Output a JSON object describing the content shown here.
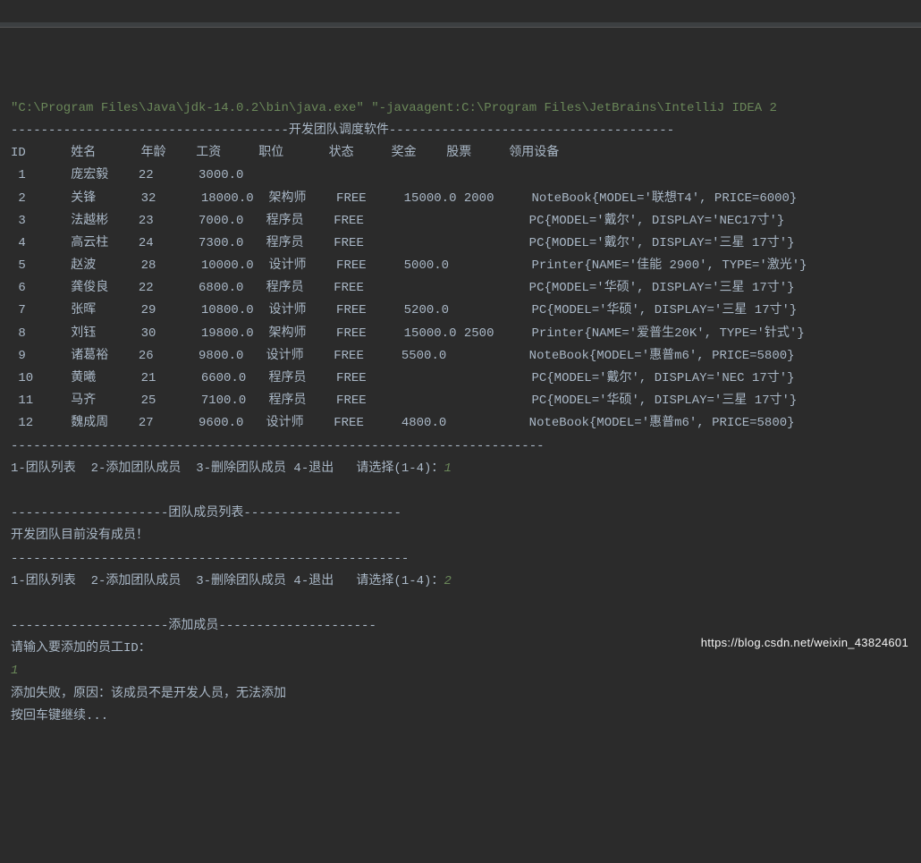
{
  "cmd": "\"C:\\Program Files\\Java\\jdk-14.0.2\\bin\\java.exe\" \"-javaagent:C:\\Program Files\\JetBrains\\IntelliJ IDEA 2",
  "title_rule": "-------------------------------------开发团队调度软件--------------------------------------",
  "headers": [
    "ID",
    "姓名",
    "年龄",
    "工资",
    "职位",
    "状态",
    "奖金",
    "股票",
    "领用设备"
  ],
  "rows": [
    {
      "id": " 1",
      "name": "庞宏毅",
      "age": "22",
      "salary": "3000.0",
      "role": "",
      "status": "",
      "bonus": "",
      "stock": "",
      "equip": ""
    },
    {
      "id": " 2",
      "name": "关锋",
      "age": "32",
      "salary": "18000.0",
      "role": "架构师",
      "status": "FREE",
      "bonus": "15000.0",
      "stock": "2000",
      "equip": "NoteBook{MODEL='联想T4', PRICE=6000}"
    },
    {
      "id": " 3",
      "name": "法越彬",
      "age": "23",
      "salary": "7000.0",
      "role": "程序员",
      "status": "FREE",
      "bonus": "",
      "stock": "",
      "equip": "PC{MODEL='戴尔', DISPLAY='NEC17寸'}"
    },
    {
      "id": " 4",
      "name": "高云柱",
      "age": "24",
      "salary": "7300.0",
      "role": "程序员",
      "status": "FREE",
      "bonus": "",
      "stock": "",
      "equip": "PC{MODEL='戴尔', DISPLAY='三星 17寸'}"
    },
    {
      "id": " 5",
      "name": "赵波",
      "age": "28",
      "salary": "10000.0",
      "role": "设计师",
      "status": "FREE",
      "bonus": "5000.0",
      "stock": "",
      "equip": "Printer{NAME='佳能 2900', TYPE='激光'}"
    },
    {
      "id": " 6",
      "name": "龚俊良",
      "age": "22",
      "salary": "6800.0",
      "role": "程序员",
      "status": "FREE",
      "bonus": "",
      "stock": "",
      "equip": "PC{MODEL='华硕', DISPLAY='三星 17寸'}"
    },
    {
      "id": " 7",
      "name": "张晖",
      "age": "29",
      "salary": "10800.0",
      "role": "设计师",
      "status": "FREE",
      "bonus": "5200.0",
      "stock": "",
      "equip": "PC{MODEL='华硕', DISPLAY='三星 17寸'}"
    },
    {
      "id": " 8",
      "name": "刘钰",
      "age": "30",
      "salary": "19800.0",
      "role": "架构师",
      "status": "FREE",
      "bonus": "15000.0",
      "stock": "2500",
      "equip": "Printer{NAME='爱普生20K', TYPE='针式'}"
    },
    {
      "id": " 9",
      "name": "诸葛裕",
      "age": "26",
      "salary": "9800.0",
      "role": "设计师",
      "status": "FREE",
      "bonus": "5500.0",
      "stock": "",
      "equip": "NoteBook{MODEL='惠普m6', PRICE=5800}"
    },
    {
      "id": " 10",
      "name": "黄曦",
      "age": "21",
      "salary": "6600.0",
      "role": "程序员",
      "status": "FREE",
      "bonus": "",
      "stock": "",
      "equip": "PC{MODEL='戴尔', DISPLAY='NEC 17寸'}"
    },
    {
      "id": " 11",
      "name": "马齐",
      "age": "25",
      "salary": "7100.0",
      "role": "程序员",
      "status": "FREE",
      "bonus": "",
      "stock": "",
      "equip": "PC{MODEL='华硕', DISPLAY='三星 17寸'}"
    },
    {
      "id": " 12",
      "name": "魏成周",
      "age": "27",
      "salary": "9600.0",
      "role": "设计师",
      "status": "FREE",
      "bonus": "4800.0",
      "stock": "",
      "equip": "NoteBook{MODEL='惠普m6', PRICE=5800}"
    }
  ],
  "rule_short": "-----------------------------------------------------------------------",
  "menu": "1-团队列表  2-添加团队成员  3-删除团队成员 4-退出   请选择(1-4)：",
  "input1": "1",
  "blank": "",
  "section_list": "---------------------团队成员列表---------------------",
  "empty_msg": "开发团队目前没有成员！",
  "rule_short2": "-----------------------------------------------------",
  "input2": "2",
  "section_add": "---------------------添加成员---------------------",
  "prompt_id": "请输入要添加的员工ID：",
  "input3": "1",
  "fail_msg": "添加失败，原因：该成员不是开发人员，无法添加",
  "continue_msg": "按回车键继续...",
  "watermark": "https://blog.csdn.net/weixin_43824601"
}
